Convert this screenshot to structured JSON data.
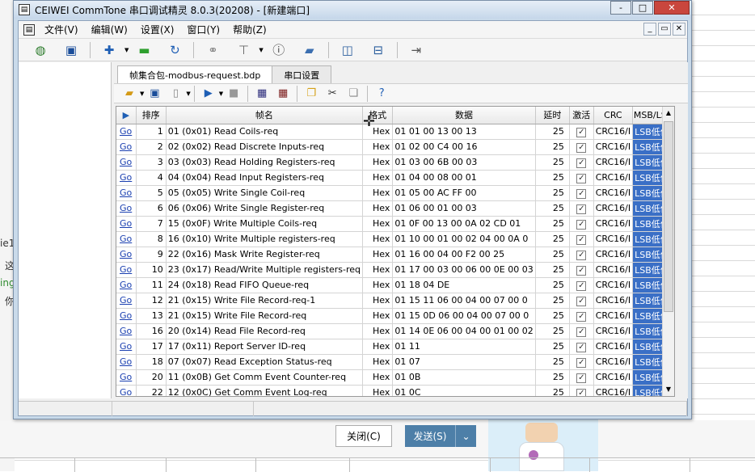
{
  "window": {
    "title": "CEIWEI CommTone 串口调试精灵 8.0.3(20208) - [新建端口]",
    "controls": [
      "-",
      "□",
      "✕"
    ]
  },
  "menubar": {
    "items": [
      "文件(V)",
      "编辑(W)",
      "设置(X)",
      "窗口(Y)",
      "帮助(Z)"
    ],
    "mdi_controls": [
      "_",
      "▭",
      "✕"
    ]
  },
  "toolbar": {
    "icons": [
      "globe-icon",
      "save-icon",
      "add-icon",
      "connect-icon",
      "refresh-icon",
      "binoculars-icon",
      "antenna-icon",
      "info-icon",
      "book-icon",
      "split-vertical-icon",
      "split-horizontal-icon",
      "exit-icon"
    ]
  },
  "tabs": [
    {
      "label": "帧集合包-modbus-request.bdp",
      "active": true
    },
    {
      "label": "串口设置",
      "active": false
    }
  ],
  "toolbar2": {
    "icons": [
      "open-folder-icon",
      "save-icon",
      "new-file-icon",
      "play-icon",
      "stop-icon",
      "grid-a-icon",
      "grid-b-icon",
      "copy-icon",
      "cut-icon",
      "paste-icon",
      "help-icon"
    ]
  },
  "grid": {
    "columns": [
      "",
      "排序",
      "帧名",
      "格式",
      "数据",
      "延时",
      "激活",
      "CRC",
      "MSB/LSB"
    ],
    "rows": [
      {
        "go": "Go",
        "order": "1",
        "name": "01 (0x01) Read Coils-req",
        "fmt": "Hex",
        "data": "01 01  00 13 00 13",
        "delay": "25",
        "active": "✓",
        "crc": "CRC16/I",
        "msb": "LSB低位"
      },
      {
        "go": "Go",
        "order": "2",
        "name": "02 (0x02) Read Discrete Inputs-req",
        "fmt": "Hex",
        "data": "01 02  00 C4 00 16",
        "delay": "25",
        "active": "✓",
        "crc": "CRC16/I",
        "msb": "LSB低位"
      },
      {
        "go": "Go",
        "order": "3",
        "name": "03 (0x03) Read Holding Registers-req",
        "fmt": "Hex",
        "data": "01 03  00 6B 00 03",
        "delay": "25",
        "active": "✓",
        "crc": "CRC16/I",
        "msb": "LSB低位"
      },
      {
        "go": "Go",
        "order": "4",
        "name": "04 (0x04) Read Input Registers-req",
        "fmt": "Hex",
        "data": "01 04  00 08 00 01",
        "delay": "25",
        "active": "✓",
        "crc": "CRC16/I",
        "msb": "LSB低位"
      },
      {
        "go": "Go",
        "order": "5",
        "name": "05 (0x05) Write Single Coil-req",
        "fmt": "Hex",
        "data": "01 05 00 AC FF 00",
        "delay": "25",
        "active": "✓",
        "crc": "CRC16/I",
        "msb": "LSB低位"
      },
      {
        "go": "Go",
        "order": "6",
        "name": "06 (0x06) Write Single Register-req",
        "fmt": "Hex",
        "data": "01 06 00 01 00 03",
        "delay": "25",
        "active": "✓",
        "crc": "CRC16/I",
        "msb": "LSB低位"
      },
      {
        "go": "Go",
        "order": "7",
        "name": "15 (0x0F) Write Multiple Coils-req",
        "fmt": "Hex",
        "data": "01 0F 00 13 00 0A 02 CD 01",
        "delay": "25",
        "active": "✓",
        "crc": "CRC16/I",
        "msb": "LSB低位"
      },
      {
        "go": "Go",
        "order": "8",
        "name": "16 (0x10) Write Multiple registers-req",
        "fmt": "Hex",
        "data": "01 10 00 01 00 02 04 00 0A 0",
        "delay": "25",
        "active": "✓",
        "crc": "CRC16/I",
        "msb": "LSB低位"
      },
      {
        "go": "Go",
        "order": "9",
        "name": "22 (0x16) Mask Write Register-req",
        "fmt": "Hex",
        "data": "01 16 00 04 00 F2 00 25",
        "delay": "25",
        "active": "✓",
        "crc": "CRC16/I",
        "msb": "LSB低位"
      },
      {
        "go": "Go",
        "order": "10",
        "name": "23 (0x17) Read/Write Multiple registers-req",
        "fmt": "Hex",
        "data": "01 17 00 03 00 06 00 0E 00 03",
        "delay": "25",
        "active": "✓",
        "crc": "CRC16/I",
        "msb": "LSB低位"
      },
      {
        "go": "Go",
        "order": "11",
        "name": "24 (0x18) Read FIFO Queue-req",
        "fmt": "Hex",
        "data": "01 18 04 DE",
        "delay": "25",
        "active": "✓",
        "crc": "CRC16/I",
        "msb": "LSB低位"
      },
      {
        "go": "Go",
        "order": "12",
        "name": "21 (0x15) Write File Record-req-1",
        "fmt": "Hex",
        "data": "01 15 11 06 00 04  00 07 00 0",
        "delay": "25",
        "active": "✓",
        "crc": "CRC16/I",
        "msb": "LSB低位"
      },
      {
        "go": "Go",
        "order": "13",
        "name": "21 (0x15) Write File Record-req",
        "fmt": "Hex",
        "data": "01 15 0D 06 00 04  00 07 00 0",
        "delay": "25",
        "active": "✓",
        "crc": "CRC16/I",
        "msb": "LSB低位"
      },
      {
        "go": "Go",
        "order": "16",
        "name": "20 (0x14) Read File Record-req",
        "fmt": "Hex",
        "data": "01 14 0E 06 00 04 00 01 00 02",
        "delay": "25",
        "active": "✓",
        "crc": "CRC16/I",
        "msb": "LSB低位"
      },
      {
        "go": "Go",
        "order": "17",
        "name": "17 (0x11) Report  Server  ID-req",
        "fmt": "Hex",
        "data": "01 11",
        "delay": "25",
        "active": "✓",
        "crc": "CRC16/I",
        "msb": "LSB低位"
      },
      {
        "go": "Go",
        "order": "18",
        "name": "07 (0x07) Read Exception Status-req",
        "fmt": "Hex",
        "data": "01 07",
        "delay": "25",
        "active": "✓",
        "crc": "CRC16/I",
        "msb": "LSB低位"
      },
      {
        "go": "Go",
        "order": "20",
        "name": "11 (0x0B) Get Comm Event Counter-req",
        "fmt": "Hex",
        "data": "01 0B",
        "delay": "25",
        "active": "✓",
        "crc": "CRC16/I",
        "msb": "LSB低位"
      },
      {
        "go": "Go",
        "order": "22",
        "name": "12 (0x0C) Get Comm Event Log-req",
        "fmt": "Hex",
        "data": "01 0C",
        "delay": "25",
        "active": "✓",
        "crc": "CRC16/I",
        "msb": "LSB低位"
      }
    ]
  },
  "background": {
    "left_texts": [
      "ie1",
      "这",
      "ing",
      "你"
    ],
    "close_button": "关闭(C)",
    "send_button": "发送(S)"
  }
}
